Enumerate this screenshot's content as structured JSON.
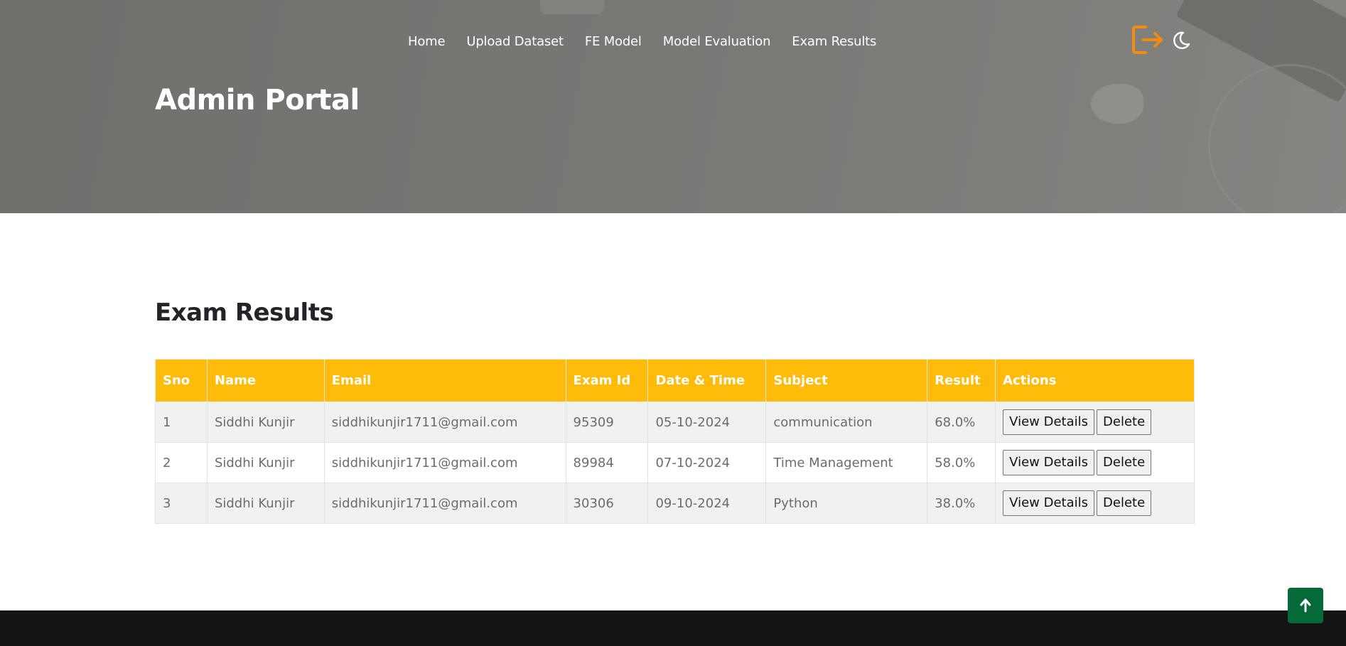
{
  "nav": {
    "items": [
      {
        "label": "Home"
      },
      {
        "label": "Upload Dataset"
      },
      {
        "label": "FE Model"
      },
      {
        "label": "Model Evaluation"
      },
      {
        "label": "Exam Results"
      }
    ]
  },
  "header": {
    "title": "Admin Portal",
    "icons": {
      "logout": "logout-icon",
      "theme": "moon-icon"
    },
    "accent_color": "#f28c0f"
  },
  "results": {
    "title": "Exam Results",
    "columns": [
      "Sno",
      "Name",
      "Email",
      "Exam Id",
      "Date & Time",
      "Subject",
      "Result",
      "Actions"
    ],
    "header_color": "#ffbb0a",
    "rows": [
      {
        "sno": "1",
        "name": "Siddhi Kunjir",
        "email": "siddhikunjir1711@gmail.com",
        "exam_id": "95309",
        "datetime": "05-10-2024",
        "subject": "communication",
        "result": "68.0%",
        "view_label": "View Details",
        "delete_label": "Delete"
      },
      {
        "sno": "2",
        "name": "Siddhi Kunjir",
        "email": "siddhikunjir1711@gmail.com",
        "exam_id": "89984",
        "datetime": "07-10-2024",
        "subject": "Time Management",
        "result": "58.0%",
        "view_label": "View Details",
        "delete_label": "Delete"
      },
      {
        "sno": "3",
        "name": "Siddhi Kunjir",
        "email": "siddhikunjir1711@gmail.com",
        "exam_id": "30306",
        "datetime": "09-10-2024",
        "subject": "Python",
        "result": "38.0%",
        "view_label": "View Details",
        "delete_label": "Delete"
      }
    ]
  },
  "back_to_top": {
    "icon": "arrow-up-icon",
    "color": "#056a3a"
  }
}
